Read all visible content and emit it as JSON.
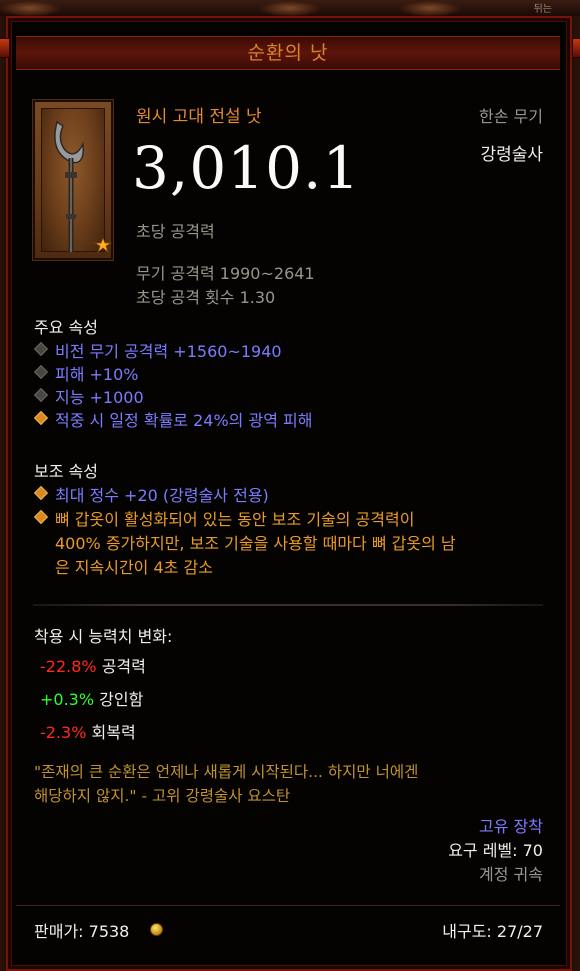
{
  "item": {
    "name": "순환의 낫",
    "quality": "원시 고대 전설 낫",
    "slot": "한손 무기",
    "class": "강령술사",
    "dps": "3,010.1",
    "dps_label": "초당 공격력",
    "weapon_damage": "무기 공격력 1990~2641",
    "attacks_per_second": "초당 공격 횟수 1.30",
    "icon": "scythe-icon",
    "rank_icon": "star-icon"
  },
  "primary": {
    "header": "주요 속성",
    "lines": [
      {
        "text": "비전 무기 공격력 +1560~1940",
        "bullet": "gray"
      },
      {
        "text": "피해 +10%",
        "bullet": "gray"
      },
      {
        "text": "지능 +1000",
        "bullet": "gray"
      },
      {
        "text": "적중 시 일정 확률로 24%의 광역 피해",
        "bullet": "orange"
      }
    ]
  },
  "secondary": {
    "header": "보조 속성",
    "line1": "최대 정수 +20 (강령술사 전용)",
    "line2": [
      "뼈 갑옷이 활성화되어 있는 동안 보조 기술의 공격력이",
      "400% 증가하지만, 보조 기술을 사용할 때마다 뼈 갑옷의 남",
      "은 지속시간이 4초 감소"
    ]
  },
  "stat_changes": {
    "header": "착용 시 능력치 변화:",
    "rows": [
      {
        "delta": "-22.8%",
        "stat": "공격력",
        "color": "#ff2b18"
      },
      {
        "delta": "+0.3%",
        "stat": "강인함",
        "color": "#2eff2a"
      },
      {
        "delta": "-2.3%",
        "stat": "회복력",
        "color": "#ff2b18"
      }
    ]
  },
  "flavor": [
    "\"존재의 큰 순환은 언제나 새롭게 시작된다... 하지만 너에겐",
    "해당하지 않지.\" - 고위 강령술사 요스탄"
  ],
  "meta": {
    "unique": "고유 장착",
    "level": "요구 레벨: 70",
    "bound": "계정 귀속"
  },
  "footer": {
    "sell": "판매가: 7538",
    "durability": "내구도: 27/27"
  },
  "top_corner_text": "뒤는"
}
